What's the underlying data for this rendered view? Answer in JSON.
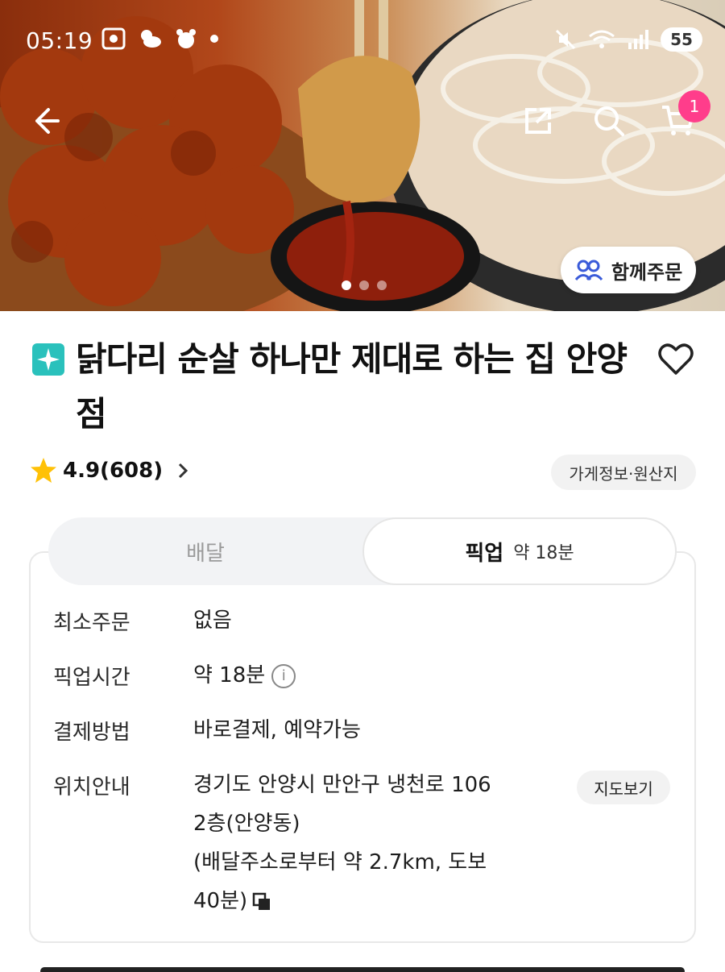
{
  "status_bar": {
    "time": "05:19",
    "battery": "55"
  },
  "hero": {
    "group_order_label": "함께주문",
    "cart_count": "1",
    "carousel_pages": 3,
    "carousel_active": 0
  },
  "store": {
    "name": "닭다리 순살 하나만 제대로 하는 집 안양점",
    "rating": "4.9(608)",
    "info_chip": "가게정보·원산지"
  },
  "tabs": {
    "delivery": "배달",
    "pickup": "픽업",
    "pickup_time": "약 18분"
  },
  "details": {
    "min_order_label": "최소주문",
    "min_order_value": "없음",
    "pickup_time_label": "픽업시간",
    "pickup_time_value": "약 18분",
    "payment_label": "결제방법",
    "payment_value": "바로결제, 예약가능",
    "location_label": "위치안내",
    "address_line1": "경기도 안양시 만안구 냉천로 106",
    "address_line2": "2층(안양동)",
    "distance_line1": "(배달주소로부터 약 2.7km, 도보",
    "distance_line2": "40분)",
    "map_button": "지도보기"
  },
  "colors": {
    "accent_teal": "#2ac1bc",
    "badge_pink": "#ff3d8b",
    "star": "#ffc107"
  }
}
